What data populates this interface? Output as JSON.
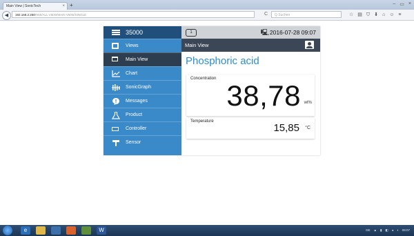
{
  "browser": {
    "tab_title": "Main View | SonicTech",
    "tab_close": "×",
    "new_tab": "+",
    "window_buttons": [
      "–",
      "▭",
      "×"
    ],
    "back": "◀",
    "url_host": "192.168.2.250",
    "url_path": "/HMI/ALL VIEW/MAIN VIEW/SINGLE",
    "reload": "C",
    "search_placeholder": "Q Suchen",
    "nav_icons": [
      "☆",
      "▤",
      "⛉",
      "⬇",
      "⌂",
      "☺",
      "≡"
    ]
  },
  "app": {
    "device_number": "35000",
    "sidebar": [
      {
        "label": "Views",
        "icon": "views-icon"
      },
      {
        "label": "Main View",
        "icon": "monitor-icon",
        "active": true
      },
      {
        "label": "Chart",
        "icon": "chart-icon"
      },
      {
        "label": "SonicGraph",
        "icon": "sonicgraph-icon"
      },
      {
        "label": "Messages",
        "icon": "messages-icon"
      },
      {
        "label": "Product",
        "icon": "flask-icon"
      },
      {
        "label": "Controller",
        "icon": "controller-icon"
      },
      {
        "label": "Sensor",
        "icon": "sensor-icon"
      }
    ],
    "page_badge": "1",
    "datetime": "2016-07-28 09:07",
    "view_title": "Main View",
    "product_name": "Phosphoric acid",
    "concentration": {
      "label": "Concentration",
      "value": "38,78",
      "unit": "wt%"
    },
    "temperature": {
      "label": "Temperature",
      "value": "15,85",
      "unit": "°C"
    }
  },
  "taskbar": {
    "tray_text": [
      "DE",
      "▲",
      "▮",
      "◧",
      "◂",
      "◖",
      "09:07"
    ]
  },
  "colors": {
    "sidebar": "#3a89c8",
    "sidebar_active": "#2c3e50",
    "header_dark": "#3b4756",
    "accent_text": "#2a8fd0"
  }
}
